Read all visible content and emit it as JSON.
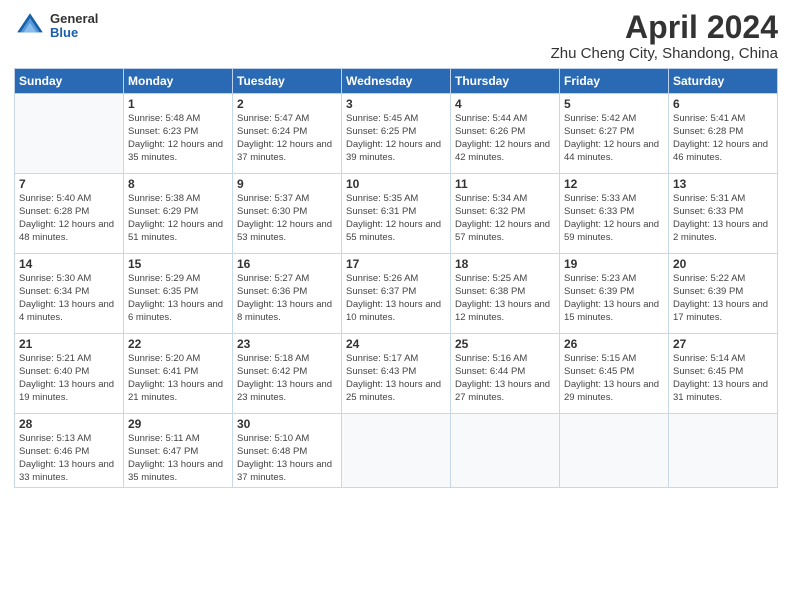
{
  "logo": {
    "general": "General",
    "blue": "Blue"
  },
  "title": "April 2024",
  "subtitle": "Zhu Cheng City, Shandong, China",
  "weekdays": [
    "Sunday",
    "Monday",
    "Tuesday",
    "Wednesday",
    "Thursday",
    "Friday",
    "Saturday"
  ],
  "weeks": [
    [
      {
        "day": "",
        "sunrise": "",
        "sunset": "",
        "daylight": ""
      },
      {
        "day": "1",
        "sunrise": "Sunrise: 5:48 AM",
        "sunset": "Sunset: 6:23 PM",
        "daylight": "Daylight: 12 hours and 35 minutes."
      },
      {
        "day": "2",
        "sunrise": "Sunrise: 5:47 AM",
        "sunset": "Sunset: 6:24 PM",
        "daylight": "Daylight: 12 hours and 37 minutes."
      },
      {
        "day": "3",
        "sunrise": "Sunrise: 5:45 AM",
        "sunset": "Sunset: 6:25 PM",
        "daylight": "Daylight: 12 hours and 39 minutes."
      },
      {
        "day": "4",
        "sunrise": "Sunrise: 5:44 AM",
        "sunset": "Sunset: 6:26 PM",
        "daylight": "Daylight: 12 hours and 42 minutes."
      },
      {
        "day": "5",
        "sunrise": "Sunrise: 5:42 AM",
        "sunset": "Sunset: 6:27 PM",
        "daylight": "Daylight: 12 hours and 44 minutes."
      },
      {
        "day": "6",
        "sunrise": "Sunrise: 5:41 AM",
        "sunset": "Sunset: 6:28 PM",
        "daylight": "Daylight: 12 hours and 46 minutes."
      }
    ],
    [
      {
        "day": "7",
        "sunrise": "Sunrise: 5:40 AM",
        "sunset": "Sunset: 6:28 PM",
        "daylight": "Daylight: 12 hours and 48 minutes."
      },
      {
        "day": "8",
        "sunrise": "Sunrise: 5:38 AM",
        "sunset": "Sunset: 6:29 PM",
        "daylight": "Daylight: 12 hours and 51 minutes."
      },
      {
        "day": "9",
        "sunrise": "Sunrise: 5:37 AM",
        "sunset": "Sunset: 6:30 PM",
        "daylight": "Daylight: 12 hours and 53 minutes."
      },
      {
        "day": "10",
        "sunrise": "Sunrise: 5:35 AM",
        "sunset": "Sunset: 6:31 PM",
        "daylight": "Daylight: 12 hours and 55 minutes."
      },
      {
        "day": "11",
        "sunrise": "Sunrise: 5:34 AM",
        "sunset": "Sunset: 6:32 PM",
        "daylight": "Daylight: 12 hours and 57 minutes."
      },
      {
        "day": "12",
        "sunrise": "Sunrise: 5:33 AM",
        "sunset": "Sunset: 6:33 PM",
        "daylight": "Daylight: 12 hours and 59 minutes."
      },
      {
        "day": "13",
        "sunrise": "Sunrise: 5:31 AM",
        "sunset": "Sunset: 6:33 PM",
        "daylight": "Daylight: 13 hours and 2 minutes."
      }
    ],
    [
      {
        "day": "14",
        "sunrise": "Sunrise: 5:30 AM",
        "sunset": "Sunset: 6:34 PM",
        "daylight": "Daylight: 13 hours and 4 minutes."
      },
      {
        "day": "15",
        "sunrise": "Sunrise: 5:29 AM",
        "sunset": "Sunset: 6:35 PM",
        "daylight": "Daylight: 13 hours and 6 minutes."
      },
      {
        "day": "16",
        "sunrise": "Sunrise: 5:27 AM",
        "sunset": "Sunset: 6:36 PM",
        "daylight": "Daylight: 13 hours and 8 minutes."
      },
      {
        "day": "17",
        "sunrise": "Sunrise: 5:26 AM",
        "sunset": "Sunset: 6:37 PM",
        "daylight": "Daylight: 13 hours and 10 minutes."
      },
      {
        "day": "18",
        "sunrise": "Sunrise: 5:25 AM",
        "sunset": "Sunset: 6:38 PM",
        "daylight": "Daylight: 13 hours and 12 minutes."
      },
      {
        "day": "19",
        "sunrise": "Sunrise: 5:23 AM",
        "sunset": "Sunset: 6:39 PM",
        "daylight": "Daylight: 13 hours and 15 minutes."
      },
      {
        "day": "20",
        "sunrise": "Sunrise: 5:22 AM",
        "sunset": "Sunset: 6:39 PM",
        "daylight": "Daylight: 13 hours and 17 minutes."
      }
    ],
    [
      {
        "day": "21",
        "sunrise": "Sunrise: 5:21 AM",
        "sunset": "Sunset: 6:40 PM",
        "daylight": "Daylight: 13 hours and 19 minutes."
      },
      {
        "day": "22",
        "sunrise": "Sunrise: 5:20 AM",
        "sunset": "Sunset: 6:41 PM",
        "daylight": "Daylight: 13 hours and 21 minutes."
      },
      {
        "day": "23",
        "sunrise": "Sunrise: 5:18 AM",
        "sunset": "Sunset: 6:42 PM",
        "daylight": "Daylight: 13 hours and 23 minutes."
      },
      {
        "day": "24",
        "sunrise": "Sunrise: 5:17 AM",
        "sunset": "Sunset: 6:43 PM",
        "daylight": "Daylight: 13 hours and 25 minutes."
      },
      {
        "day": "25",
        "sunrise": "Sunrise: 5:16 AM",
        "sunset": "Sunset: 6:44 PM",
        "daylight": "Daylight: 13 hours and 27 minutes."
      },
      {
        "day": "26",
        "sunrise": "Sunrise: 5:15 AM",
        "sunset": "Sunset: 6:45 PM",
        "daylight": "Daylight: 13 hours and 29 minutes."
      },
      {
        "day": "27",
        "sunrise": "Sunrise: 5:14 AM",
        "sunset": "Sunset: 6:45 PM",
        "daylight": "Daylight: 13 hours and 31 minutes."
      }
    ],
    [
      {
        "day": "28",
        "sunrise": "Sunrise: 5:13 AM",
        "sunset": "Sunset: 6:46 PM",
        "daylight": "Daylight: 13 hours and 33 minutes."
      },
      {
        "day": "29",
        "sunrise": "Sunrise: 5:11 AM",
        "sunset": "Sunset: 6:47 PM",
        "daylight": "Daylight: 13 hours and 35 minutes."
      },
      {
        "day": "30",
        "sunrise": "Sunrise: 5:10 AM",
        "sunset": "Sunset: 6:48 PM",
        "daylight": "Daylight: 13 hours and 37 minutes."
      },
      {
        "day": "",
        "sunrise": "",
        "sunset": "",
        "daylight": ""
      },
      {
        "day": "",
        "sunrise": "",
        "sunset": "",
        "daylight": ""
      },
      {
        "day": "",
        "sunrise": "",
        "sunset": "",
        "daylight": ""
      },
      {
        "day": "",
        "sunrise": "",
        "sunset": "",
        "daylight": ""
      }
    ]
  ]
}
